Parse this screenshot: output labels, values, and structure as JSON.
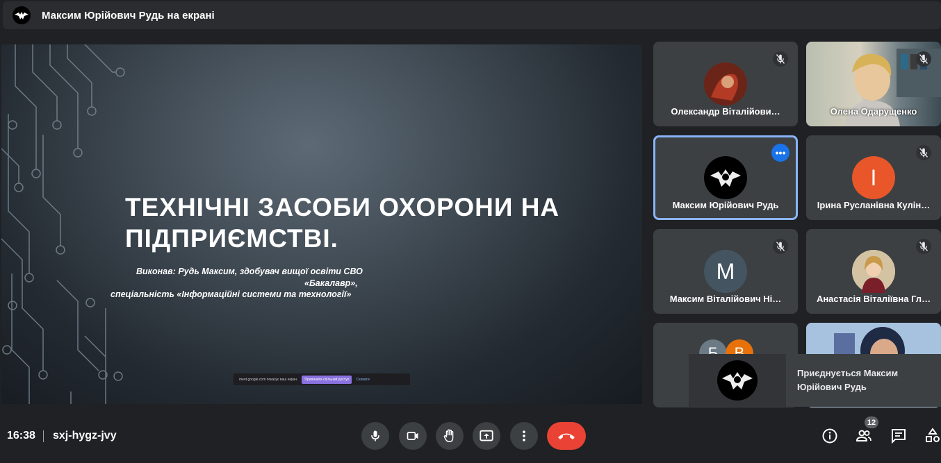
{
  "header": {
    "title": "Максим Юрійович Рудь на екрані"
  },
  "presentation": {
    "title": "ТЕХНІЧНІ ЗАСОБИ ОХОРОНИ НА ПІДПРИЄМСТВІ.",
    "line1": "Виконав: Рудь Максим, здобувач вищої освіти СВО",
    "line2": "«Бакалавр»,",
    "line3": "спеціальність «Інформаційні системи та технології»",
    "share_text": "meet.google.com показує ваш екран.",
    "stop_share_label": "Припинити спільний доступ",
    "hide_label": "Сховати"
  },
  "participants": [
    {
      "name": "Олександр Віталійови…",
      "muted": true
    },
    {
      "name": "Олена Одарущенко",
      "muted": true
    },
    {
      "name": "Максим Юрійович Рудь",
      "muted": false,
      "active": true
    },
    {
      "name": "Ірина Русланівна Кулін…",
      "initial": "I",
      "color": "#e8562a",
      "muted": true
    },
    {
      "name": "Максим Віталійович Ні…",
      "initial": "M",
      "color": "#445561",
      "muted": true
    },
    {
      "name": "Анастасія Віталіївна Гл…",
      "muted": true
    },
    {
      "initial_a": "Б",
      "initial_b": "В"
    }
  ],
  "toast": {
    "text": "Приєднується Максим Юрійович Рудь"
  },
  "footer": {
    "time": "16:38",
    "meeting_code": "sxj-hygz-jvy",
    "people_count": "12"
  },
  "colors": {
    "accent": "#8ab4f8",
    "end_call": "#ea4335",
    "more_button": "#1a73e8"
  }
}
